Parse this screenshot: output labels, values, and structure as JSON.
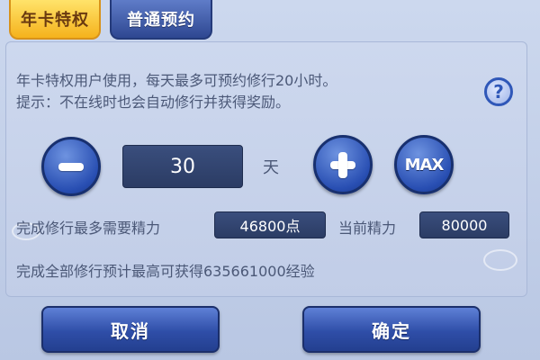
{
  "tabs": [
    {
      "label": "年卡特权",
      "active": true
    },
    {
      "label": "普通预约",
      "active": false
    }
  ],
  "description": {
    "line1": "年卡特权用户使用，每天最多可预约修行20小时。",
    "line2": "提示：不在线时也会自动修行并获得奖励。"
  },
  "help_icon_glyph": "?",
  "stepper": {
    "value": "30",
    "unit": "天",
    "max_label": "MAX"
  },
  "energy": {
    "required_label": "完成修行最多需要精力",
    "required_value": "46800点",
    "current_label": "当前精力",
    "current_value": "80000"
  },
  "reward_text": "完成全部修行预计最高可获得635661000经验",
  "buttons": {
    "cancel": "取消",
    "confirm": "确定"
  },
  "colors": {
    "active_tab": "#f5b21c",
    "inactive_tab": "#2e4791",
    "button_blue": "#2f4ea8",
    "panel_bg": "#c4d1ea",
    "text": "#4b5877"
  },
  "icons": [
    "minus-icon",
    "plus-icon",
    "help-icon"
  ]
}
